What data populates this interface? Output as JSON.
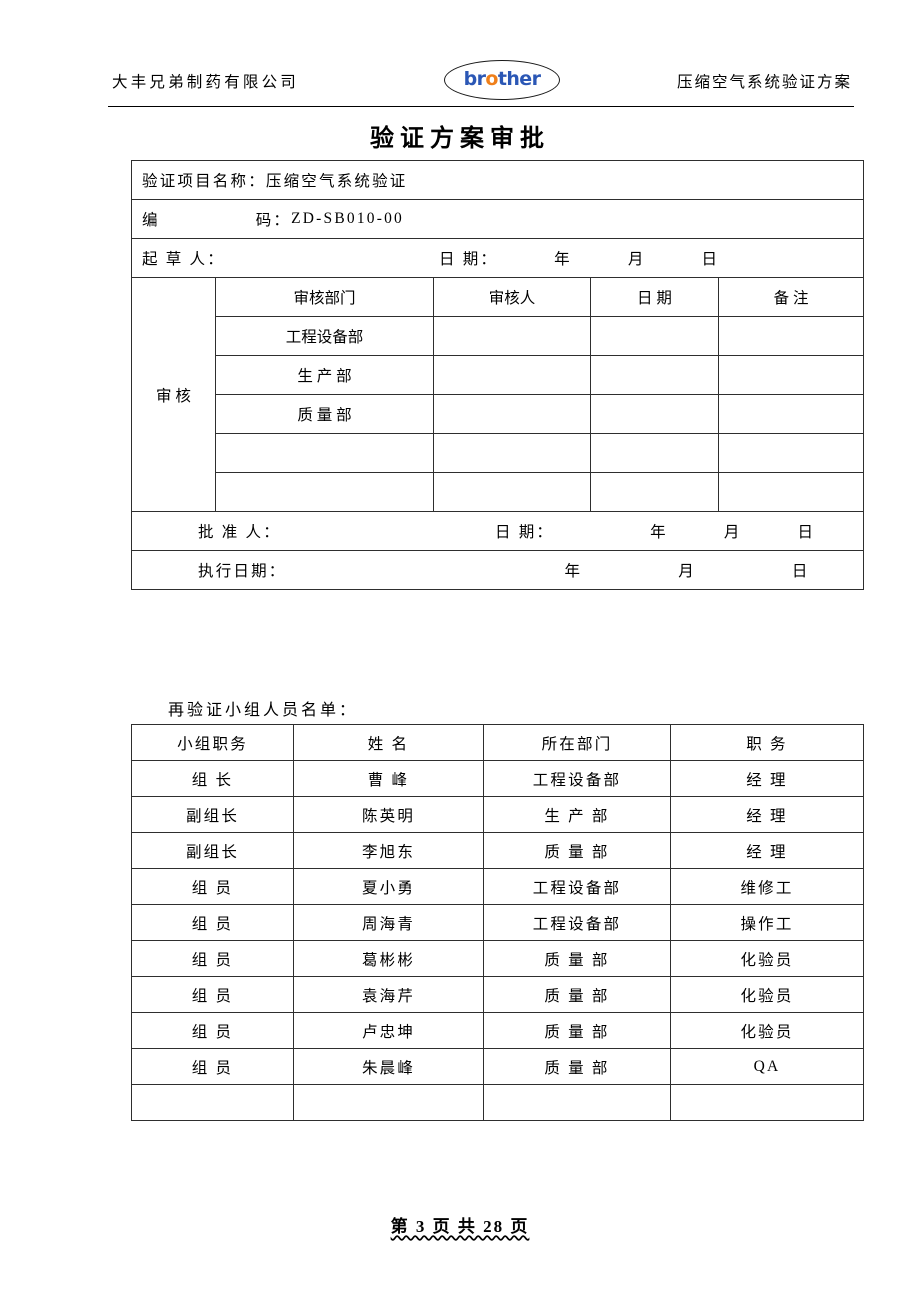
{
  "header": {
    "company": "大丰兄弟制药有限公司",
    "document_name": "压缩空气系统验证方案",
    "logo": {
      "text_before": "br",
      "text_accent": "o",
      "text_after": "ther"
    }
  },
  "title": "验证方案审批",
  "approval": {
    "project_name_label": "验证项目名称：",
    "project_name_value": "压缩空气系统验证",
    "code_label_a": "编",
    "code_label_b": "码：",
    "code_value": "ZD-SB010-00",
    "drafter_label": "起  草  人：",
    "date_label": "日    期：",
    "year": "年",
    "month": "月",
    "day": "日",
    "review_label": "审   核",
    "columns": {
      "department": "审核部门",
      "reviewer": "审核人",
      "date": "日    期",
      "remark": "备    注"
    },
    "departments": [
      "工程设备部",
      "生    产    部",
      "质    量    部",
      "",
      ""
    ],
    "approver_label": "批  准  人：",
    "approver_date_label": "日    期：",
    "execution_date_label": "执行日期：",
    "execution_year": "年",
    "execution_month": "月",
    "execution_day": "日"
  },
  "roster": {
    "title": "再验证小组人员名单：",
    "columns": [
      "小组职务",
      "姓    名",
      "所在部门",
      "职    务"
    ],
    "rows": [
      [
        "组  长",
        "曹  峰",
        "工程设备部",
        "经  理"
      ],
      [
        "副组长",
        "陈英明",
        "生    产    部",
        "经  理"
      ],
      [
        "副组长",
        "李旭东",
        "质    量    部",
        "经  理"
      ],
      [
        "组    员",
        "夏小勇",
        "工程设备部",
        "维修工"
      ],
      [
        "组    员",
        "周海青",
        "工程设备部",
        "操作工"
      ],
      [
        "组    员",
        "葛彬彬",
        "质    量    部",
        "化验员"
      ],
      [
        "组    员",
        "袁海芹",
        "质    量    部",
        "化验员"
      ],
      [
        "组    员",
        "卢忠坤",
        "质    量    部",
        "化验员"
      ],
      [
        "组    员",
        "朱晨峰",
        "质    量    部",
        "QA"
      ],
      [
        "",
        "",
        "",
        ""
      ]
    ]
  },
  "footer": {
    "page_text": "第 3 页 共 28 页"
  },
  "colors": {
    "brand_blue": "#2b57b5",
    "brand_orange": "#ef7f1a",
    "rule": "#000000",
    "table_border": "#2e2e2e"
  }
}
